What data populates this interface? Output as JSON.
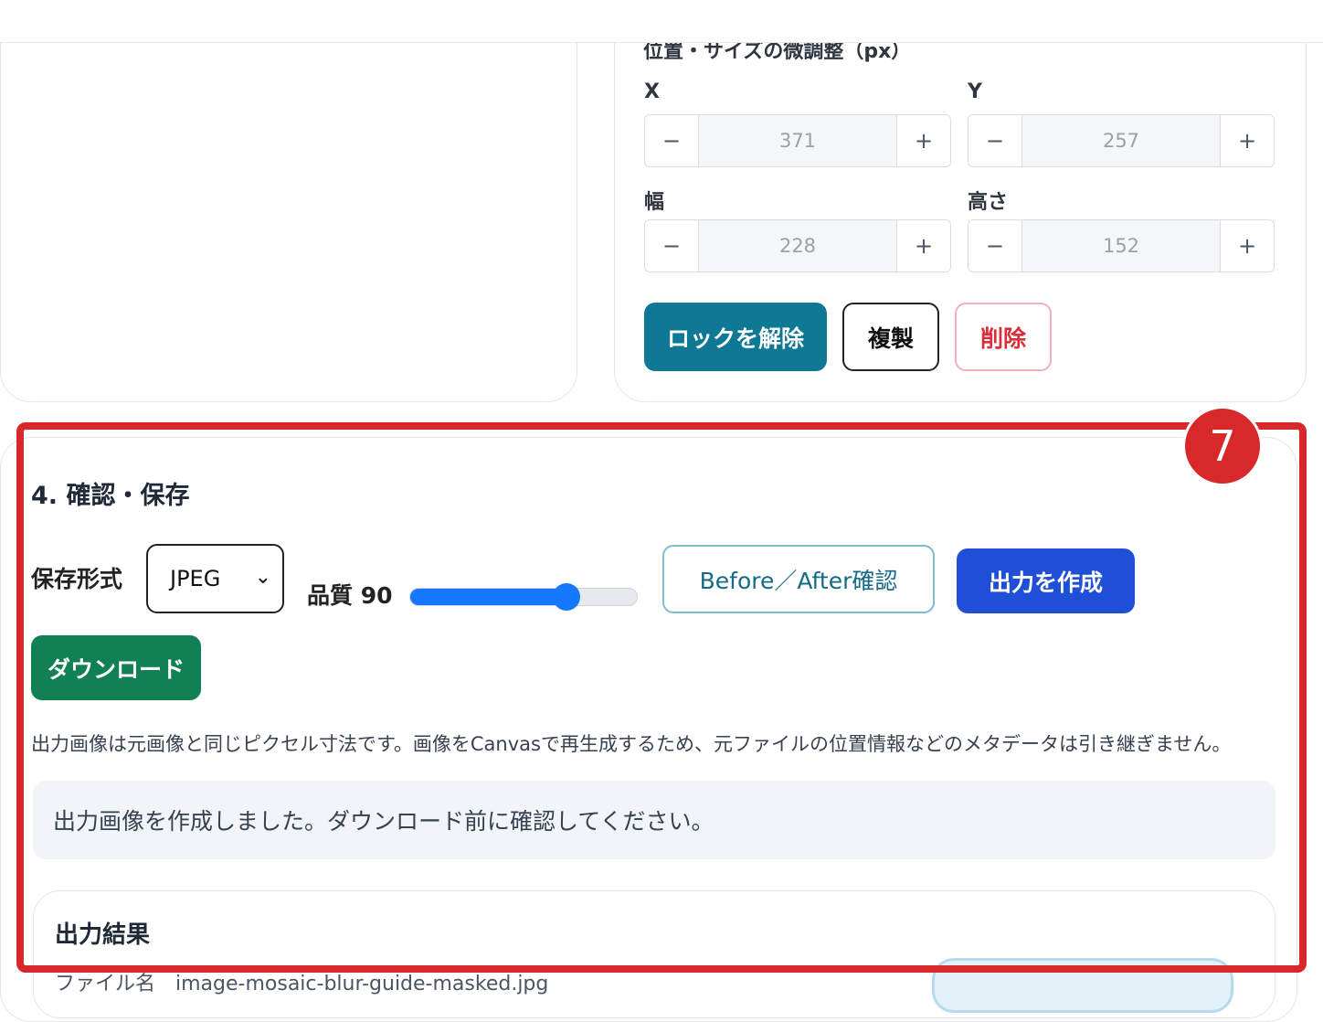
{
  "adjust_panel": {
    "heading": "位置・サイズの微調整（px）",
    "fields": [
      {
        "label": "X",
        "value": "371"
      },
      {
        "label": "Y",
        "value": "257"
      },
      {
        "label": "幅",
        "value": "228"
      },
      {
        "label": "高さ",
        "value": "152"
      }
    ],
    "stepper_minus": "−",
    "stepper_plus": "+",
    "unlock_label": "ロックを解除",
    "duplicate_label": "複製",
    "delete_label": "削除"
  },
  "badge": {
    "number": "7"
  },
  "save_section": {
    "title": "4. 確認・保存",
    "format_label": "保存形式",
    "format_value": "JPEG",
    "quality_label": "品質 90",
    "quality_value": 90,
    "quality_max": 100,
    "before_after_label": "Before／After確認",
    "create_label": "出力を作成",
    "download_label": "ダウンロード",
    "note": "出力画像は元画像と同じピクセル寸法です。画像をCanvasで再生成するため、元ファイルの位置情報などのメタデータは引き継ぎません。",
    "info_message": "出力画像を作成しました。ダウンロード前に確認してください。",
    "result_title": "出力結果",
    "result_filename": "ファイル名　image-mosaic-blur-guide-masked.jpg"
  },
  "colors": {
    "accent_teal": "#0f7894",
    "primary_blue": "#1e4fd6",
    "download_green": "#128055",
    "highlight_red": "#d7282c",
    "slider_blue": "#1677ff"
  }
}
